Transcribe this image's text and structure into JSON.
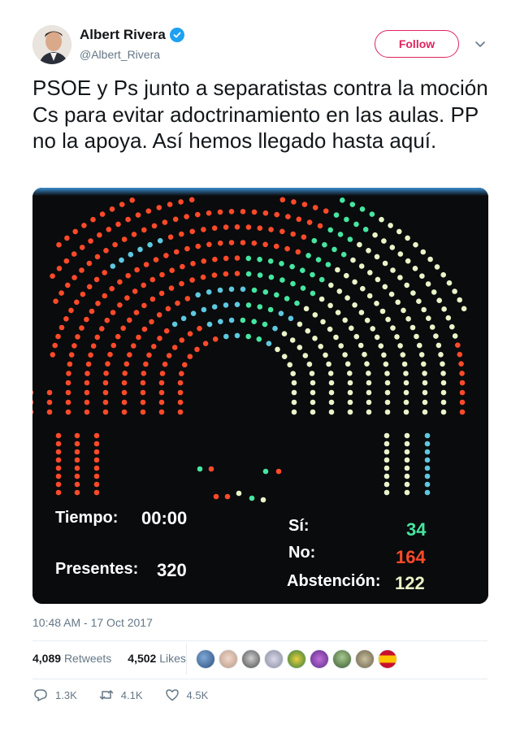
{
  "author": {
    "name": "Albert Rivera",
    "handle": "@Albert_Rivera",
    "verified": true
  },
  "follow_label": "Follow",
  "tweet": {
    "text": "PSOE y Ps junto a separatistas contra la moción Cs para evitar adoctrinamiento en las aulas. PP no la apoya. Así hemos llegado hasta aquí."
  },
  "media": {
    "tiempo_label": "Tiempo:",
    "tiempo_value": "00:00",
    "presentes_label": "Presentes:",
    "presentes_value": "320",
    "si_label": "Sí:",
    "si_value": "34",
    "no_label": "No:",
    "no_value": "164",
    "abstencion_label": "Abstención:",
    "abstencion_value": "122",
    "colors": {
      "si": "#46e6a0",
      "no": "#ff4a2a",
      "abstencion": "#e8f5c8",
      "absent": "#5ec8e0"
    }
  },
  "timestamp": "10:48 AM - 17 Oct 2017",
  "stats": {
    "retweets_count": "4,089",
    "retweets_label": "Retweets",
    "likes_count": "4,502",
    "likes_label": "Likes"
  },
  "actions": {
    "replies": "1.3K",
    "retweets": "4.1K",
    "likes": "4.5K"
  },
  "icons": [
    "verified-badge-icon",
    "chevron-down-icon",
    "reply-icon",
    "retweet-icon",
    "heart-icon"
  ],
  "accent_color": "#e0245e",
  "link_color": "#1da1f2"
}
